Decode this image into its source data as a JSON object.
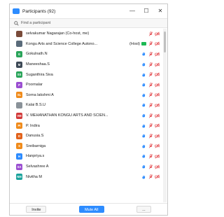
{
  "window": {
    "title": "Participants (92)",
    "minimize": "—",
    "maximize": "☐",
    "close": "✕"
  },
  "search": {
    "placeholder": "Find a participant"
  },
  "participants": [
    {
      "initials": "",
      "avatar_color": "#7a4b3a",
      "name": "selvakumar Nagarajan (Co-host, me)",
      "hand": false,
      "badge": "",
      "video_on": false,
      "muted": true
    },
    {
      "initials": "",
      "avatar_color": "#5a6b7a",
      "name": "Kongu Arts and Science College Autono...",
      "hand": false,
      "badge": "(Host)",
      "video_on": true,
      "muted": true
    },
    {
      "initials": "G",
      "avatar_color": "#2aa45a",
      "name": "Gokulnath.N",
      "hand": true,
      "badge": "",
      "video_on": false,
      "muted": true
    },
    {
      "initials": "M",
      "avatar_color": "#3e4a57",
      "name": "Maneeshaa.S",
      "hand": true,
      "badge": "",
      "video_on": false,
      "muted": true
    },
    {
      "initials": "SS",
      "avatar_color": "#2aa45a",
      "name": "Suganthira Siva",
      "hand": true,
      "badge": "",
      "video_on": false,
      "muted": true
    },
    {
      "initials": "P",
      "avatar_color": "#9b4fd1",
      "name": "Poornalar",
      "hand": true,
      "badge": "",
      "video_on": false,
      "muted": true
    },
    {
      "initials": "SL",
      "avatar_color": "#f08b1b",
      "name": "Sorna lakshmi A",
      "hand": true,
      "badge": "",
      "video_on": false,
      "muted": true
    },
    {
      "initials": "",
      "avatar_color": "#8a9299",
      "name": "Kalai B.S.U",
      "hand": true,
      "badge": "",
      "video_on": false,
      "muted": true
    },
    {
      "initials": "VM",
      "avatar_color": "#d23a3a",
      "name": "V. MEHANATHAN KONGU ARTS AND SCIEN...",
      "hand": true,
      "badge": "",
      "video_on": false,
      "muted": true
    },
    {
      "initials": "PI",
      "avatar_color": "#f08b1b",
      "name": "P. Indira",
      "hand": true,
      "badge": "",
      "video_on": false,
      "muted": true
    },
    {
      "initials": "D",
      "avatar_color": "#e2631c",
      "name": "Danusia.S",
      "hand": true,
      "badge": "",
      "video_on": false,
      "muted": true
    },
    {
      "initials": "S",
      "avatar_color": "#f08b1b",
      "name": "Sreibarniga",
      "hand": true,
      "badge": "",
      "video_on": false,
      "muted": true
    },
    {
      "initials": "H",
      "avatar_color": "#2d8cff",
      "name": "Hanpriya.s",
      "hand": true,
      "badge": "",
      "video_on": false,
      "muted": true
    },
    {
      "initials": "SA",
      "avatar_color": "#9b4fd1",
      "name": "Selvashree A",
      "hand": true,
      "badge": "",
      "video_on": false,
      "muted": true
    },
    {
      "initials": "NM",
      "avatar_color": "#1ba39c",
      "name": "Nivitha M",
      "hand": true,
      "badge": "",
      "video_on": false,
      "muted": true
    }
  ],
  "footer": {
    "invite": "Invite",
    "mute_all": "Mute All",
    "more": "..."
  },
  "colors": {
    "accent": "#2d8cff",
    "muted_red": "#e0393e",
    "hand_blue": "#2d8cff",
    "video_green": "#1db954"
  }
}
